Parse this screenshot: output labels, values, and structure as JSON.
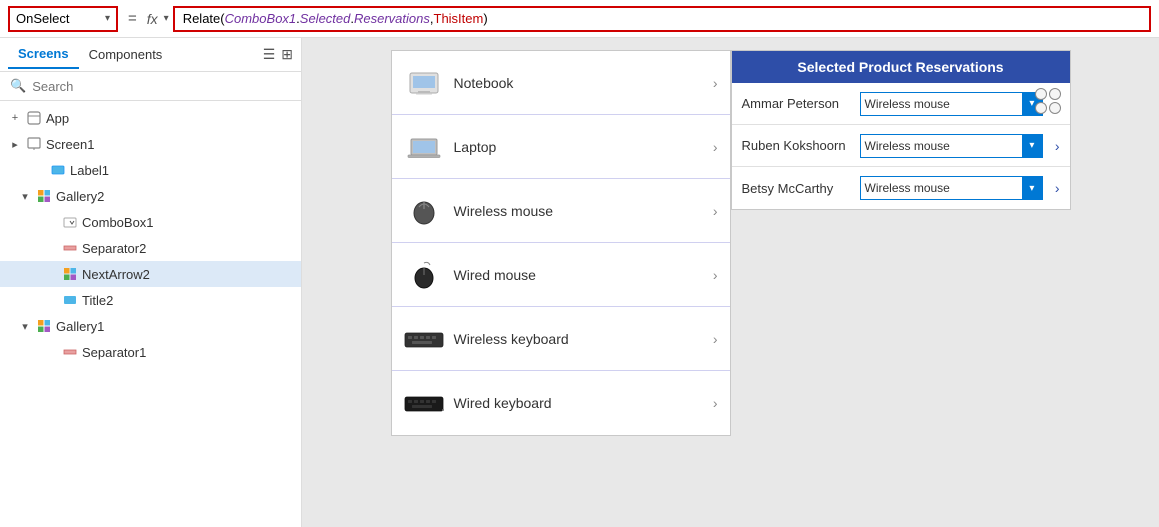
{
  "topbar": {
    "property": "OnSelect",
    "chevron": "▾",
    "equals": "=",
    "fx": "fx",
    "formula": {
      "fn": "Relate(",
      "param1": " ComboBox1",
      "dot1": ".",
      "param1b": "Selected",
      "dot2": ".",
      "param1c": "Reservations",
      "comma": ",",
      "param2": " ThisItem",
      "close": " )"
    }
  },
  "sidebar": {
    "tabs": [
      {
        "label": "Screens",
        "active": true
      },
      {
        "label": "Components",
        "active": false
      }
    ],
    "search_placeholder": "Search",
    "tree": [
      {
        "id": "app",
        "label": "App",
        "indent": 0,
        "expand": "+",
        "icon": "app"
      },
      {
        "id": "screen1",
        "label": "Screen1",
        "indent": 0,
        "expand": "▸",
        "icon": "screen"
      },
      {
        "id": "label1",
        "label": "Label1",
        "indent": 2,
        "expand": "",
        "icon": "label"
      },
      {
        "id": "gallery2",
        "label": "Gallery2",
        "indent": 1,
        "expand": "▾",
        "icon": "gallery"
      },
      {
        "id": "combobox1",
        "label": "ComboBox1",
        "indent": 3,
        "expand": "",
        "icon": "combo"
      },
      {
        "id": "separator2",
        "label": "Separator2",
        "indent": 3,
        "expand": "",
        "icon": "separator"
      },
      {
        "id": "nextarrow2",
        "label": "NextArrow2",
        "indent": 3,
        "expand": "",
        "icon": "arrow",
        "selected": true
      },
      {
        "id": "title2",
        "label": "Title2",
        "indent": 3,
        "expand": "",
        "icon": "title"
      },
      {
        "id": "gallery1",
        "label": "Gallery1",
        "indent": 1,
        "expand": "▾",
        "icon": "gallery"
      },
      {
        "id": "separator1",
        "label": "Separator1",
        "indent": 3,
        "expand": "",
        "icon": "separator"
      }
    ]
  },
  "products": [
    {
      "label": "Notebook",
      "icon": "notebook"
    },
    {
      "label": "Laptop",
      "icon": "laptop"
    },
    {
      "label": "Wireless mouse",
      "icon": "wmouse"
    },
    {
      "label": "Wired mouse",
      "icon": "wdmouse"
    },
    {
      "label": "Wireless keyboard",
      "icon": "wkbd"
    },
    {
      "label": "Wired keyboard",
      "icon": "wdkbd"
    }
  ],
  "reservations": {
    "title": "Selected Product Reservations",
    "rows": [
      {
        "person": "Ammar Peterson",
        "value": "Wireless mouse"
      },
      {
        "person": "Ruben Kokshoorn",
        "value": "Wireless mouse"
      },
      {
        "person": "Betsy McCarthy",
        "value": "Wireless mouse"
      }
    ]
  }
}
